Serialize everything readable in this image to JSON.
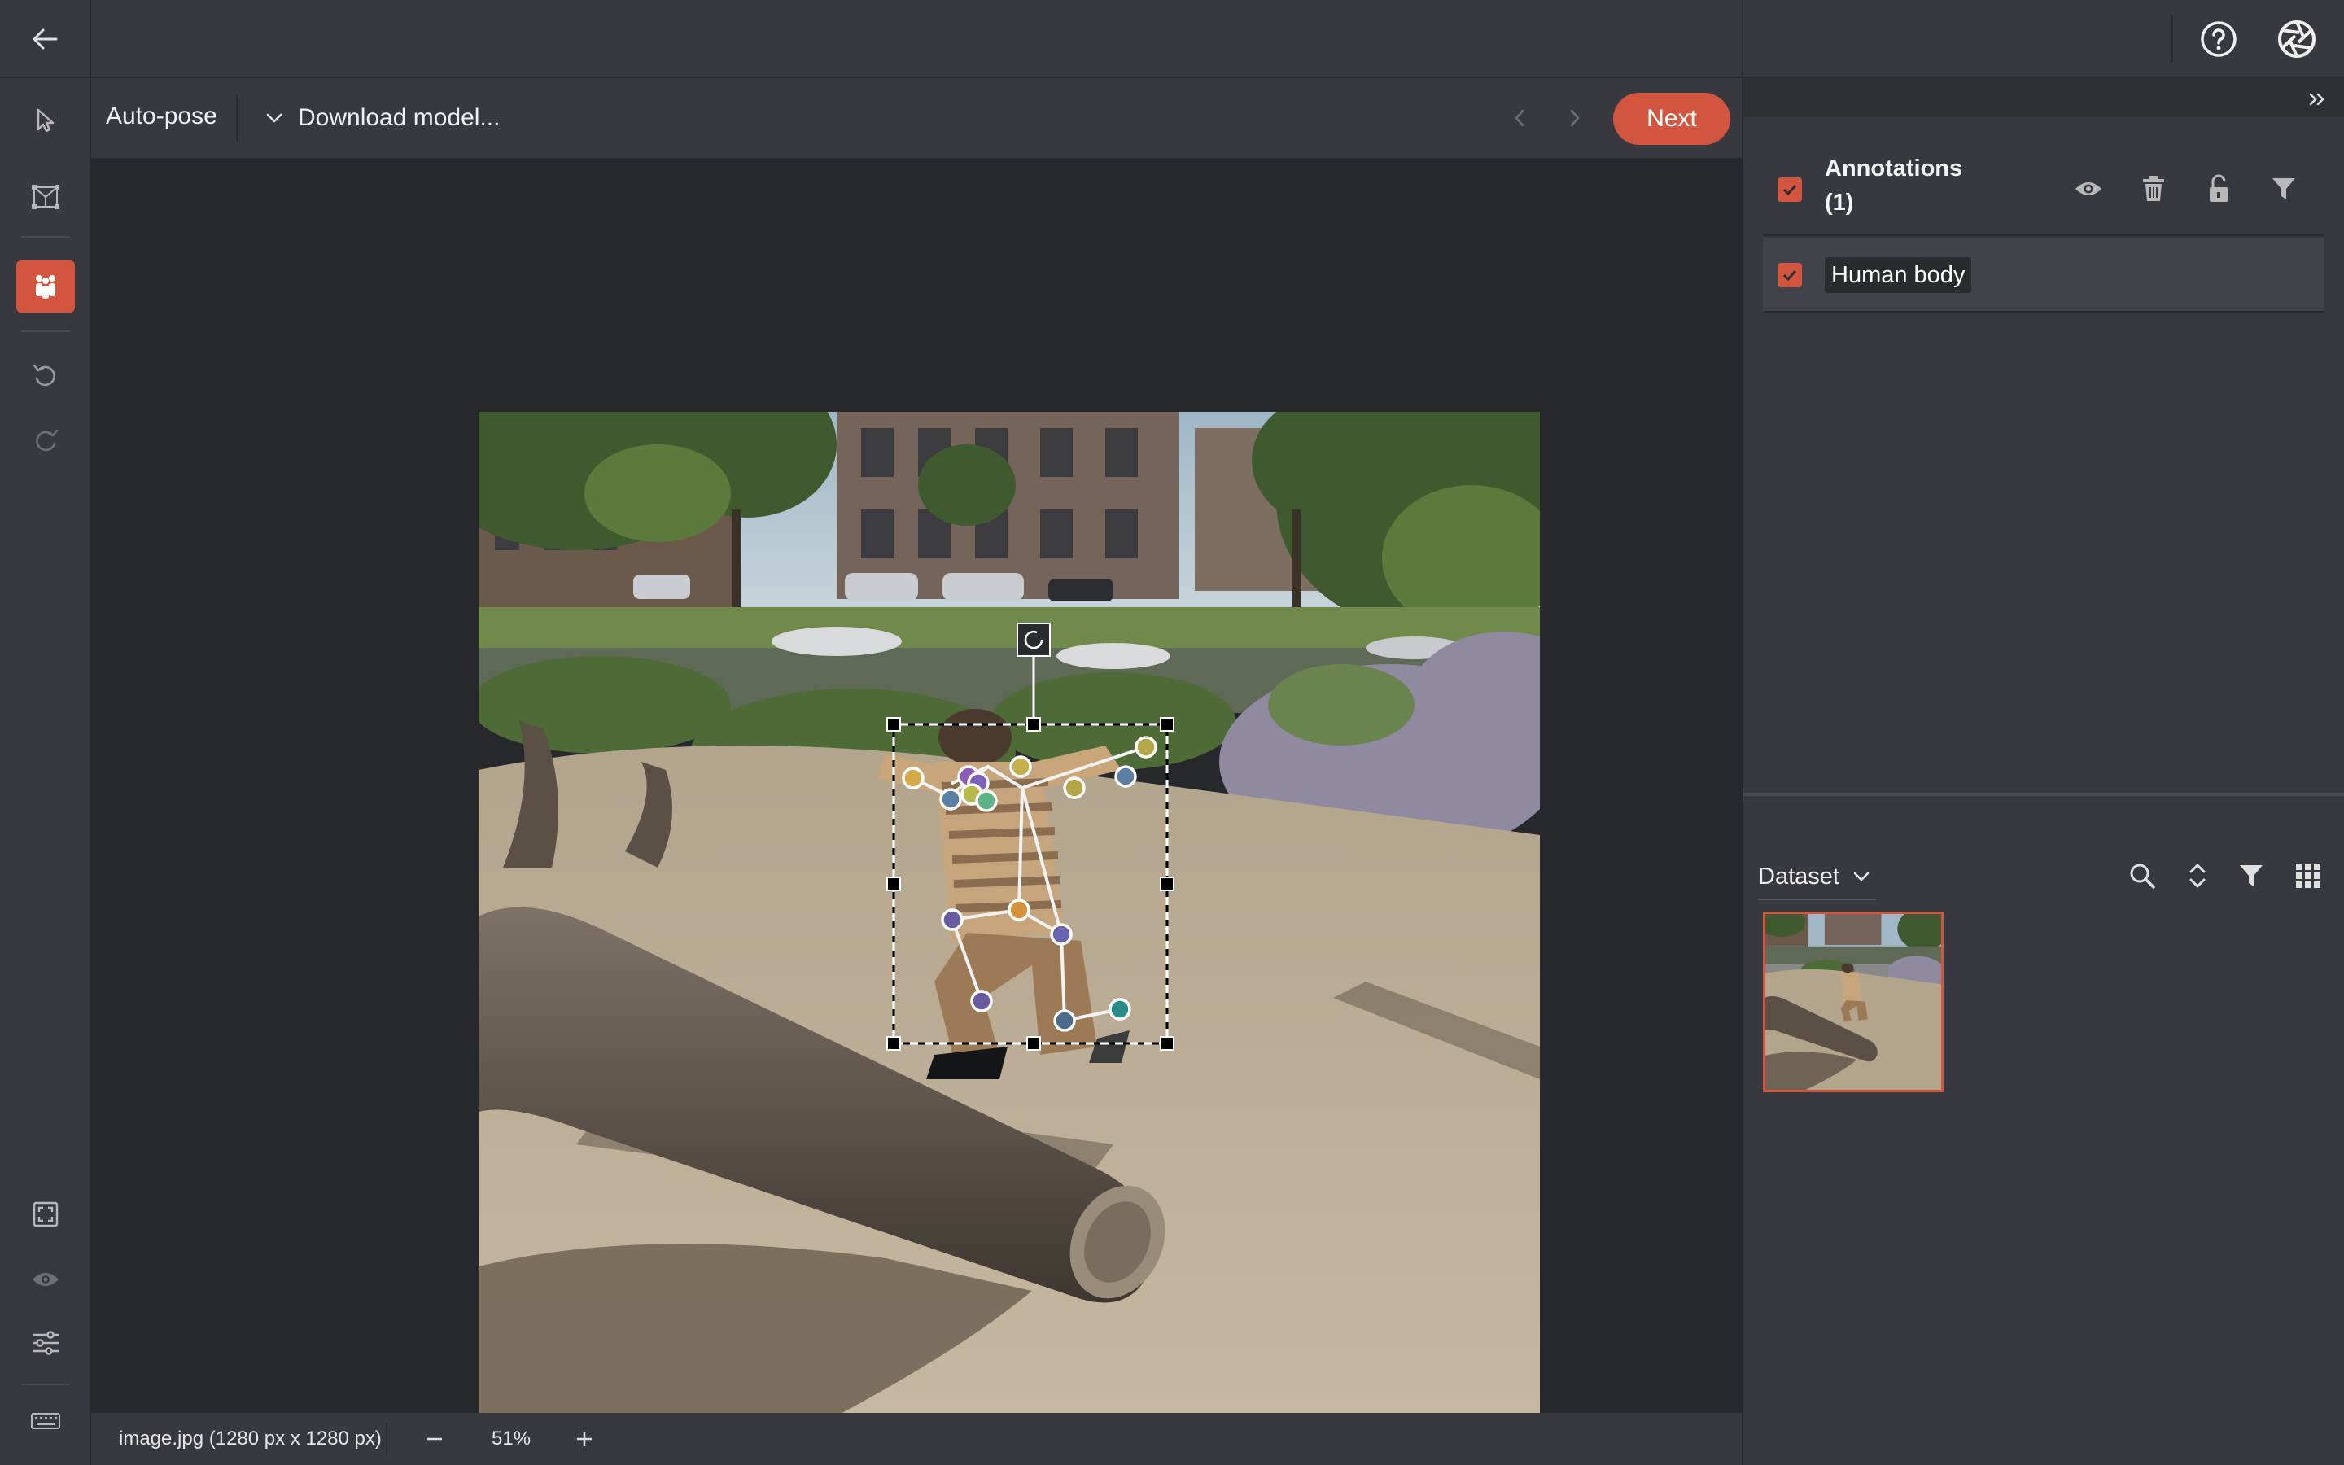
{
  "tool": {
    "name": "Auto-pose"
  },
  "model": {
    "label": "Download model..."
  },
  "nav": {
    "next_label": "Next"
  },
  "annotations": {
    "title": "Annotations",
    "count": "(1)",
    "items": [
      {
        "label": "Human body",
        "checked": true
      }
    ]
  },
  "dataset": {
    "label": "Dataset"
  },
  "status": {
    "file_info": "image.jpg (1280 px x 1280 px)",
    "zoom": "51%"
  },
  "colors": {
    "accent": "#d2563f",
    "panel": "#37393e",
    "canvas": "#27282b"
  },
  "icons": {
    "top": [
      "back-arrow-icon",
      "help-icon",
      "aperture-icon"
    ],
    "toolbar": [
      "select-icon",
      "bounding-box-icon",
      "people-icon",
      "undo-icon",
      "redo-icon",
      "fit-screen-icon",
      "eye-icon",
      "sliders-icon",
      "keyboard-icon"
    ],
    "annotations": [
      "eye-icon",
      "trash-icon",
      "unlock-icon",
      "filter-icon"
    ],
    "dataset": [
      "search-icon",
      "sort-icon",
      "filter-icon",
      "grid-icon"
    ]
  }
}
